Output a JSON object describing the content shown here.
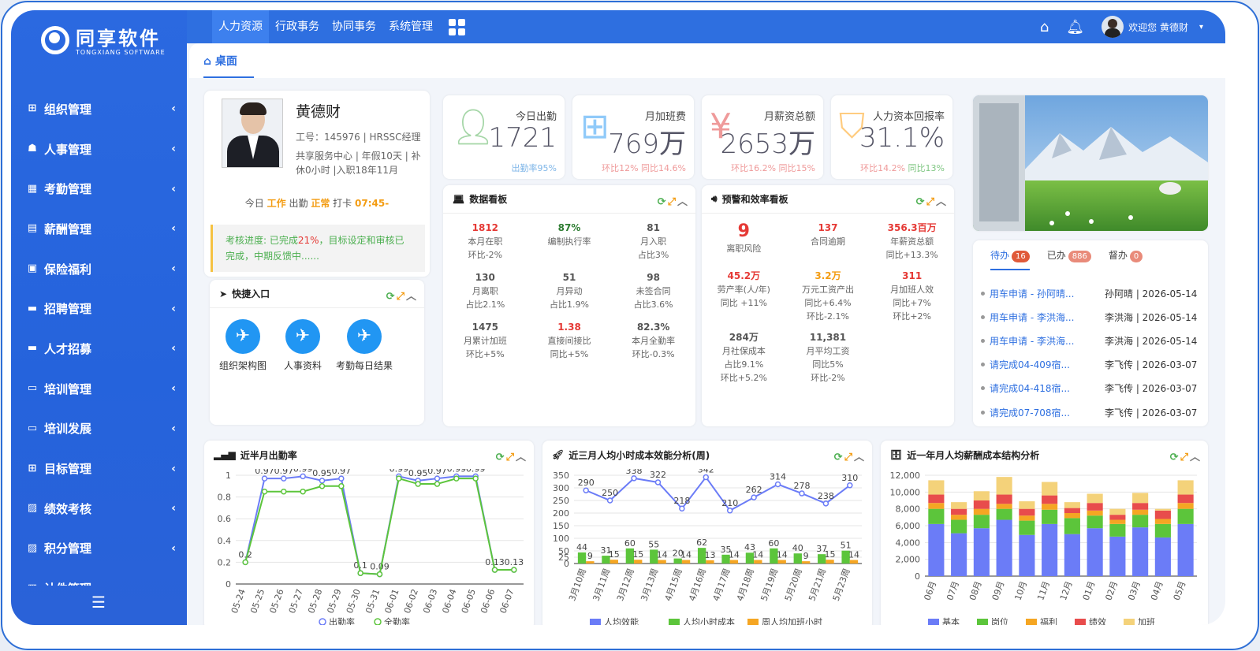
{
  "app": {
    "logo_name": "同享软件",
    "logo_sub": "TONGXIANG SOFTWARE"
  },
  "sidebar": {
    "items": [
      {
        "label": "组织管理",
        "icon": "org-icon"
      },
      {
        "label": "人事管理",
        "icon": "user-icon"
      },
      {
        "label": "考勤管理",
        "icon": "calendar-icon"
      },
      {
        "label": "薪酬管理",
        "icon": "wage-icon"
      },
      {
        "label": "保险福利",
        "icon": "insurance-icon"
      },
      {
        "label": "招聘管理",
        "icon": "briefcase-icon"
      },
      {
        "label": "人才招募",
        "icon": "briefcase-icon"
      },
      {
        "label": "培训管理",
        "icon": "monitor-icon"
      },
      {
        "label": "培训发展",
        "icon": "monitor-icon"
      },
      {
        "label": "目标管理",
        "icon": "sitemap-icon"
      },
      {
        "label": "绩效考核",
        "icon": "chart-icon"
      },
      {
        "label": "积分管理",
        "icon": "chart-icon"
      },
      {
        "label": "计件管理",
        "icon": "chart-icon"
      }
    ]
  },
  "topnav": {
    "items": [
      "人力资源",
      "行政事务",
      "协同事务",
      "系统管理"
    ],
    "welcome": "欢迎您  黄德财"
  },
  "tab": {
    "label": "桌面"
  },
  "profile": {
    "name": "黄德财",
    "id_line": "工号：145976 | HRSSC经理",
    "detail": "共享服务中心 | 年假10天 | 补休0小时 |入职18年11月",
    "today_a": "今日",
    "today_b": "工作",
    "today_c": "出勤",
    "today_d": "正常",
    "today_e": "打卡",
    "today_f": "07:45-",
    "kpi_a": "考核进度: 已完成",
    "kpi_b": "21%",
    "kpi_c": "，目标设定和审核已完成，中期反馈中......"
  },
  "quick": {
    "title": "快捷入口",
    "items": [
      "组织架构图",
      "人事资料",
      "考勤每日结果"
    ]
  },
  "stats": [
    {
      "label": "今日出勤",
      "value": "1721",
      "sub1": "出勤率95%",
      "sub2": ""
    },
    {
      "label": "月加班费",
      "value": "769万",
      "sub1": "环比12%",
      "sub2": "同比14.6%"
    },
    {
      "label": "月薪资总额",
      "value": "2653万",
      "sub1": "环比16.2%",
      "sub2": "同比15%"
    },
    {
      "label": "人力资本回报率",
      "value": "31.1%",
      "sub1": "环比14.2%",
      "sub2": "同比13%"
    }
  ],
  "databoard": {
    "title": "数据看板",
    "cells": [
      {
        "v": "1812",
        "l1": "本月在职",
        "l2": "环比-2%",
        "c": "#e53935"
      },
      {
        "v": "87%",
        "l1": "编制执行率",
        "l2": "",
        "c": "#2e7d32"
      },
      {
        "v": "81",
        "l1": "月入职",
        "l2": "占比3%",
        "c": "#555"
      },
      {
        "v": "130",
        "l1": "月离职",
        "l2": "占比2.1%",
        "c": "#555"
      },
      {
        "v": "51",
        "l1": "月异动",
        "l2": "占比1.9%",
        "c": "#555"
      },
      {
        "v": "98",
        "l1": "未签合同",
        "l2": "占比3.6%",
        "c": "#555"
      },
      {
        "v": "1475",
        "l1": "月累计加班",
        "l2": "环比+5%",
        "c": "#555"
      },
      {
        "v": "1.38",
        "l1": "直接间接比",
        "l2": "同比+5%",
        "c": "#e53935"
      },
      {
        "v": "82.3%",
        "l1": "本月全勤率",
        "l2": "环比-0.3%",
        "c": "#555"
      }
    ]
  },
  "warnboard": {
    "title": "预警和效率看板",
    "cells": [
      {
        "v": "9",
        "l1": "离职风险",
        "l2": "",
        "l3": "",
        "c": "#e53935",
        "big": true
      },
      {
        "v": "137",
        "l1": "合同逾期",
        "l2": "",
        "l3": "",
        "c": "#e53935"
      },
      {
        "v": "356.3百万",
        "l1": "年薪资总额",
        "l2": "同比+13.3%",
        "l3": "",
        "c": "#e53935"
      },
      {
        "v": "45.2万",
        "l1": "劳产率(人/年)",
        "l2": "同比 +11%",
        "l3": "",
        "c": "#e53935"
      },
      {
        "v": "3.2万",
        "l1": "万元工资产出",
        "l2": "同比+6.4%",
        "l3": "环比-2.1%",
        "c": "#f39c12"
      },
      {
        "v": "311",
        "l1": "月加班人效",
        "l2": "同比+7%",
        "l3": "环比+2%",
        "c": "#e53935"
      },
      {
        "v": "284万",
        "l1": "月社保成本",
        "l2": "占比9.1%",
        "l3": "环比+5.2%",
        "c": "#555"
      },
      {
        "v": "11,381",
        "l1": "月平均工资",
        "l2": "同比5%",
        "l3": "环比-2%",
        "c": "#555"
      }
    ]
  },
  "todo": {
    "tabs": [
      {
        "label": "待办",
        "count": "16",
        "color": "#e05a3a"
      },
      {
        "label": "已办",
        "count": "886",
        "color": "#e98b7a"
      },
      {
        "label": "督办",
        "count": "0",
        "color": "#e98b7a"
      }
    ],
    "rows": [
      {
        "t": "用车申请 - 孙阿晴...",
        "m": "孙阿晴 | 2026-05-14"
      },
      {
        "t": "用车申请 - 李洪海...",
        "m": "李洪海 | 2026-05-14"
      },
      {
        "t": "用车申请 - 李洪海...",
        "m": "李洪海 | 2026-05-14"
      },
      {
        "t": "请完成04-409宿...",
        "m": "李飞传 | 2026-03-07"
      },
      {
        "t": "请完成04-418宿...",
        "m": "李飞传 | 2026-03-07"
      },
      {
        "t": "请完成07-708宿...",
        "m": "李飞传 | 2026-03-07"
      }
    ]
  },
  "chart_titles": [
    "近半月出勤率",
    "近三月人均小时成本效能分析(周)",
    "近一年月人均薪酬成本结构分析"
  ],
  "chart_data": [
    {
      "type": "line",
      "title": "近半月出勤率",
      "x": [
        "05-24",
        "05-25",
        "05-26",
        "05-27",
        "05-28",
        "05-29",
        "05-30",
        "05-31",
        "06-01",
        "06-02",
        "06-03",
        "06-04",
        "06-05",
        "06-06",
        "06-07"
      ],
      "series": [
        {
          "name": "出勤率",
          "values": [
            0.2,
            0.97,
            0.97,
            0.99,
            0.95,
            0.97,
            0.1,
            0.09,
            0.99,
            0.95,
            0.97,
            0.99,
            0.99,
            0.13,
            0.13
          ],
          "color": "#6b7cf7"
        },
        {
          "name": "全勤率",
          "values": [
            0.2,
            0.85,
            0.85,
            0.85,
            0.9,
            0.9,
            0.1,
            0.09,
            0.97,
            0.92,
            0.92,
            0.97,
            0.97,
            0.13,
            0.13
          ],
          "color": "#5cc53b"
        }
      ],
      "ylim": [
        0,
        1
      ],
      "yticks": [
        0,
        0.2,
        0.4,
        0.6,
        0.8,
        1
      ]
    },
    {
      "type": "bar-line",
      "title": "近三月人均小时成本效能分析(周)",
      "x": [
        "3月10周",
        "3月11周",
        "3月12周",
        "3月13周",
        "4月15周",
        "4月16周",
        "4月17周",
        "4月18周",
        "5月19周",
        "5月20周",
        "5月21周",
        "5月23周"
      ],
      "series": [
        {
          "name": "人均效能",
          "type": "line",
          "values": [
            290,
            250,
            338,
            322,
            218,
            342,
            210,
            262,
            314,
            278,
            238,
            310
          ],
          "color": "#6b7cf7"
        },
        {
          "name": "人均小时成本",
          "type": "bar",
          "values": [
            44,
            31,
            60,
            55,
            20,
            62,
            35,
            43,
            60,
            40,
            37,
            51
          ],
          "color": "#5cc53b"
        },
        {
          "name": "周人均加班小时",
          "type": "bar",
          "values": [
            9,
            15,
            15,
            14,
            14,
            13,
            14,
            14,
            14,
            9,
            15,
            14
          ],
          "color": "#f5a623"
        }
      ],
      "ylim": [
        0,
        350
      ],
      "yticks": [
        0,
        25,
        50,
        100,
        150,
        200,
        250,
        300,
        350
      ]
    },
    {
      "type": "stacked-bar",
      "title": "近一年月人均薪酬成本结构分析",
      "x": [
        "06月",
        "07月",
        "08月",
        "09月",
        "10月",
        "11月",
        "12月",
        "01月",
        "02月",
        "03月",
        "04月",
        "05月"
      ],
      "series": [
        {
          "name": "基本",
          "values": [
            6200,
            5100,
            5700,
            6700,
            4900,
            6200,
            5000,
            5700,
            4700,
            5800,
            4600,
            6200
          ],
          "color": "#6b7cf7"
        },
        {
          "name": "岗位",
          "values": [
            1800,
            1600,
            1600,
            1300,
            1700,
            1700,
            1900,
            1500,
            1500,
            1500,
            1600,
            1800
          ],
          "color": "#5cc53b"
        },
        {
          "name": "福利",
          "values": [
            700,
            600,
            700,
            600,
            600,
            700,
            600,
            600,
            500,
            600,
            600,
            700
          ],
          "color": "#f5a623"
        },
        {
          "name": "绩效",
          "values": [
            1000,
            700,
            1000,
            1100,
            800,
            1000,
            600,
            900,
            600,
            800,
            1000,
            1000
          ],
          "color": "#e84c4c"
        },
        {
          "name": "加班",
          "values": [
            1700,
            800,
            1100,
            2100,
            900,
            1600,
            700,
            1100,
            700,
            1200,
            200,
            1700
          ],
          "color": "#f4d27a"
        }
      ],
      "ylim": [
        0,
        12000
      ],
      "yticks": [
        0,
        2000,
        4000,
        6000,
        8000,
        10000,
        12000
      ]
    }
  ]
}
